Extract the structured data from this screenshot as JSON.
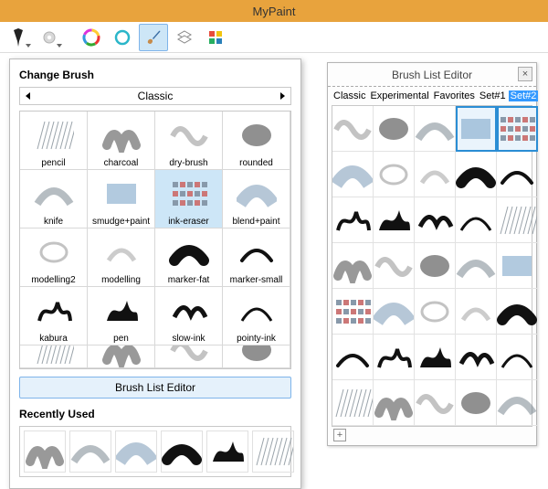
{
  "app": {
    "title": "MyPaint"
  },
  "toolbar": {
    "items": [
      {
        "name": "brush-tool-icon",
        "active": false,
        "dropdown": true
      },
      {
        "name": "gear-icon",
        "active": false,
        "dropdown": true
      },
      {
        "name": "color-wheel-icon",
        "active": false
      },
      {
        "name": "color-ring-icon",
        "active": false
      },
      {
        "name": "brush-panel-icon",
        "active": true
      },
      {
        "name": "layers-icon",
        "active": false
      },
      {
        "name": "palette-icon",
        "active": false
      }
    ]
  },
  "brush_panel": {
    "title": "Change Brush",
    "group": "Classic",
    "brushes": [
      "pencil",
      "charcoal",
      "dry-brush",
      "rounded",
      "knife",
      "smudge+paint",
      "ink-eraser",
      "blend+paint",
      "modelling2",
      "modelling",
      "marker-fat",
      "marker-small",
      "kabura",
      "pen",
      "slow-ink",
      "pointy-ink"
    ],
    "selected_index": 6,
    "editor_button": "Brush List Editor",
    "recent_title": "Recently Used",
    "recent_count": 6
  },
  "editor": {
    "title": "Brush List Editor",
    "close": "×",
    "tabs": [
      "Classic",
      "Experimental",
      "Favorites",
      "Set#1",
      "Set#2"
    ],
    "selected_tab": 4,
    "grid_count": 35,
    "selected_cells": [
      3,
      4
    ],
    "expand": "+"
  }
}
